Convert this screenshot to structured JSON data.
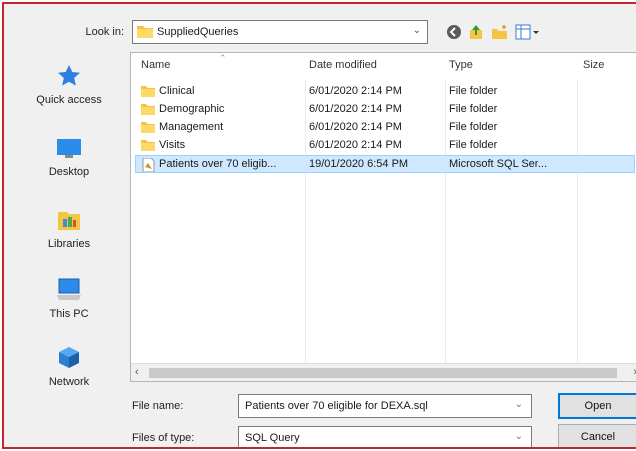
{
  "lookin": {
    "label": "Look in:",
    "value": "SuppliedQueries"
  },
  "places": [
    {
      "label": "Quick access",
      "icon": "star-icon"
    },
    {
      "label": "Desktop",
      "icon": "desktop-icon"
    },
    {
      "label": "Libraries",
      "icon": "libraries-icon"
    },
    {
      "label": "This PC",
      "icon": "computer-icon"
    },
    {
      "label": "Network",
      "icon": "network-icon"
    }
  ],
  "columns": {
    "name": "Name",
    "date": "Date modified",
    "type": "Type",
    "size": "Size"
  },
  "files": [
    {
      "name": "Clinical",
      "date": "6/01/2020 2:14 PM",
      "type": "File folder",
      "icon": "folder-icon"
    },
    {
      "name": "Demographic",
      "date": "6/01/2020 2:14 PM",
      "type": "File folder",
      "icon": "folder-icon"
    },
    {
      "name": "Management",
      "date": "6/01/2020 2:14 PM",
      "type": "File folder",
      "icon": "folder-icon"
    },
    {
      "name": "Visits",
      "date": "6/01/2020 2:14 PM",
      "type": "File folder",
      "icon": "folder-icon"
    },
    {
      "name": "Patients over 70 eligib...",
      "date": "19/01/2020 6:54 PM",
      "type": "Microsoft SQL Ser...",
      "icon": "sql-file-icon",
      "selected": true
    }
  ],
  "filename": {
    "label": "File name:",
    "value": "Patients over 70 eligible for DEXA.sql"
  },
  "filetype": {
    "label": "Files of type:",
    "value": "SQL Query"
  },
  "buttons": {
    "open": "Open",
    "cancel": "Cancel"
  },
  "colors": {
    "accent": "#0078d7",
    "selection": "#cde8ff",
    "folder": "#f6c444",
    "border": "#c0282d"
  }
}
